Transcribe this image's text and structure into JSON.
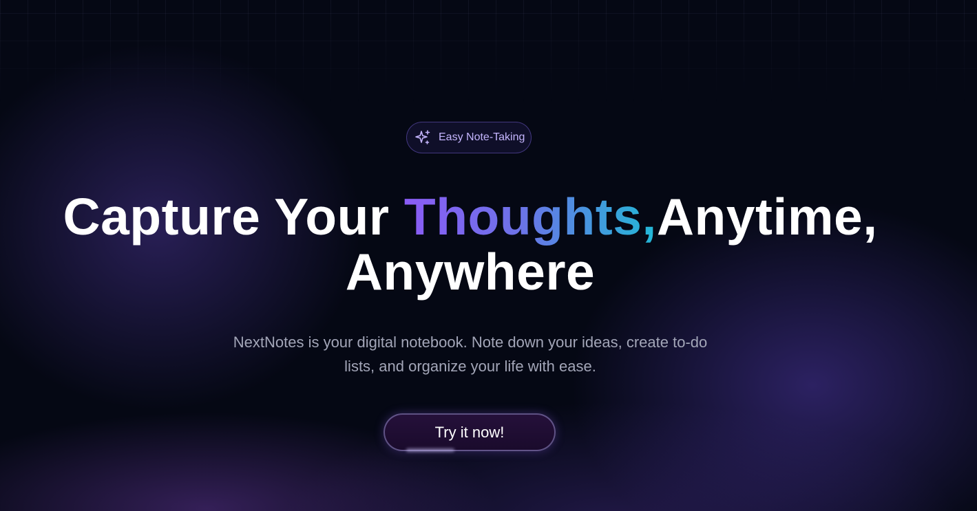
{
  "badge": {
    "icon": "sparkle-icon",
    "label": "Easy Note-Taking"
  },
  "hero": {
    "headline_start": "Capture Your ",
    "headline_accent": "Thoughts,",
    "headline_end": "Anytime,",
    "headline_line2": "Anywhere",
    "subtitle": "NextNotes is your digital notebook. Note down your ideas, create to-do lists, and organize your life with ease."
  },
  "cta": {
    "label": "Try it now!"
  },
  "colors": {
    "background": "#050814",
    "accent_start": "#8b5cf6",
    "accent_end": "#22b8d6",
    "badge_text": "#c4b5fd"
  }
}
